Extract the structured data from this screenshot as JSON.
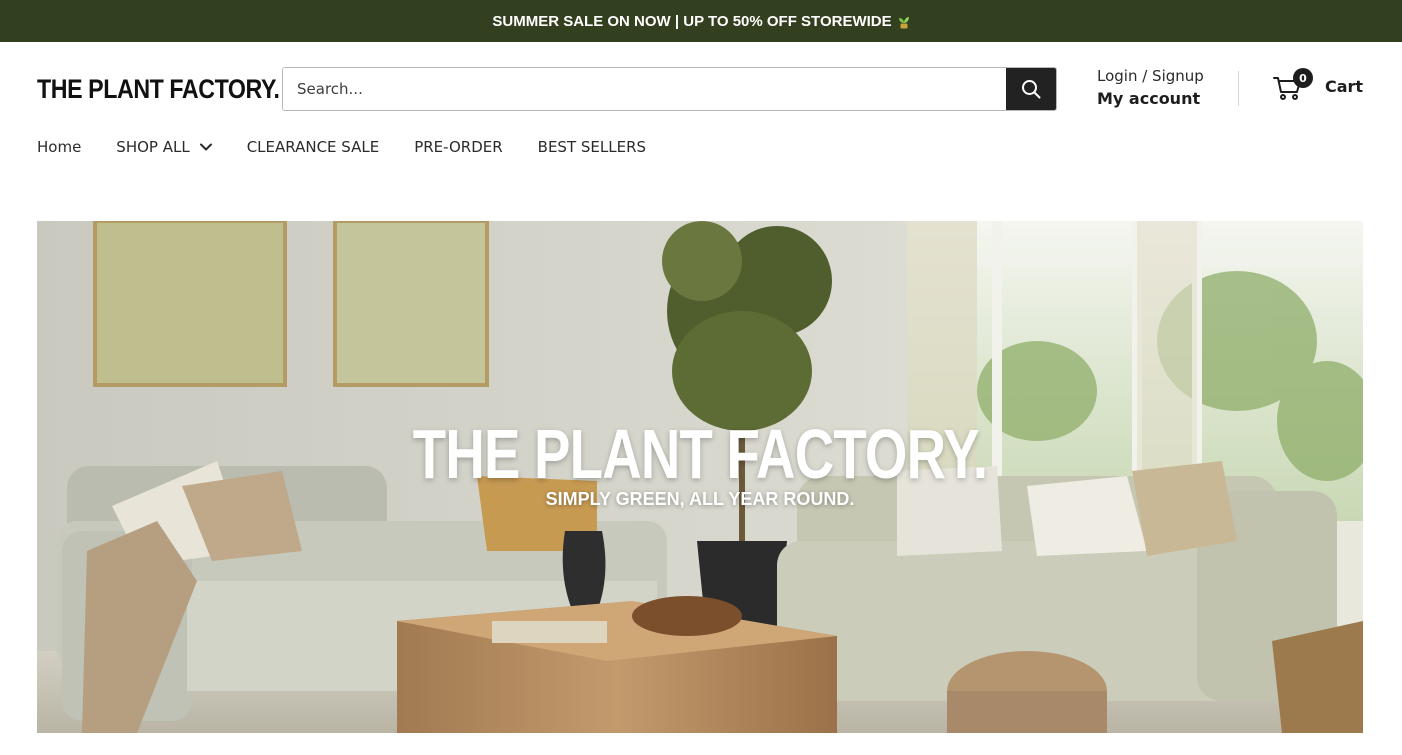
{
  "announcement": {
    "text": "SUMMER SALE ON NOW | UP TO 50% OFF STOREWIDE"
  },
  "header": {
    "logo": "THE PLANT FACTORY.",
    "search": {
      "placeholder": "Search..."
    },
    "account": {
      "login_label": "Login / Signup",
      "my_account_label": "My account"
    },
    "cart": {
      "count": "0",
      "label": "Cart"
    }
  },
  "nav": {
    "items": [
      {
        "label": "Home"
      },
      {
        "label": "SHOP ALL"
      },
      {
        "label": "CLEARANCE SALE"
      },
      {
        "label": "PRE-ORDER"
      },
      {
        "label": "BEST SELLERS"
      }
    ]
  },
  "hero": {
    "title": "THE PLANT FACTORY.",
    "subtitle": "SIMPLY GREEN, ALL YEAR ROUND."
  },
  "colors": {
    "announcement_bg": "#33401f",
    "search_button_bg": "#222222",
    "text_dark": "#1d1d1d"
  },
  "icons": [
    "sprout-icon",
    "search-icon",
    "cart-icon",
    "chevron-down-icon"
  ]
}
